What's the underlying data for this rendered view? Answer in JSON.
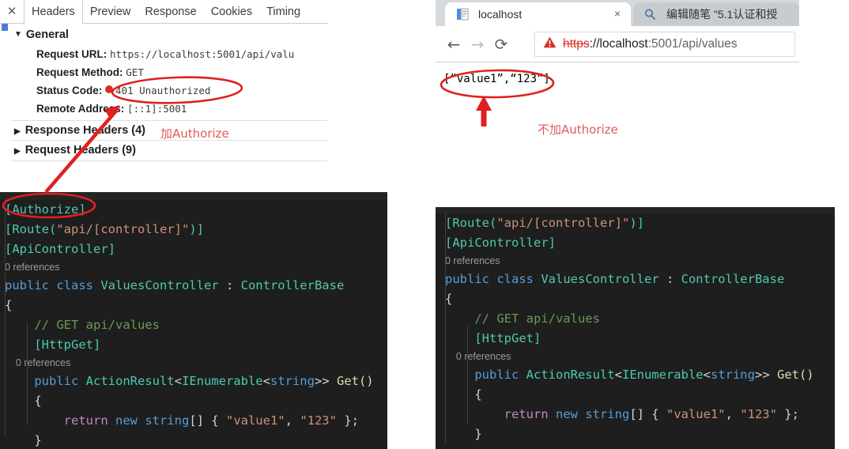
{
  "devtools": {
    "close_icon": "close-icon",
    "tabs": [
      {
        "label": "Headers",
        "selected": true
      },
      {
        "label": "Preview",
        "selected": false
      },
      {
        "label": "Response",
        "selected": false
      },
      {
        "label": "Cookies",
        "selected": false
      },
      {
        "label": "Timing",
        "selected": false
      }
    ],
    "general": {
      "section_label": "General",
      "caret": "▼",
      "rows": [
        {
          "key": "Request URL:",
          "value": "https://localhost:5001/api/valu"
        },
        {
          "key": "Request Method:",
          "value": "GET"
        },
        {
          "key": "Status Code:",
          "value": "401 Unauthorized",
          "status_color": "#d93025"
        },
        {
          "key": "Remote Address:",
          "value": "[::1]:5001"
        }
      ]
    },
    "sections": [
      {
        "label": "Response Headers (4)",
        "caret": "▶"
      },
      {
        "label": "Request Headers (9)",
        "caret": "▶"
      }
    ]
  },
  "annotations": {
    "left_note": "加Authorize",
    "right_note": "不加Authorize",
    "color": "#e05a5a"
  },
  "browser": {
    "tabs": [
      {
        "label": "localhost",
        "active": true,
        "close_icon": "×"
      },
      {
        "label": "编辑随笔 \"5.1认证和授",
        "active": false
      }
    ],
    "nav": {
      "back": "←",
      "forward": "→",
      "reload": "⟳"
    },
    "omnibox": {
      "security_icon": "not-secure-warning-icon",
      "scheme": "https",
      "separator": "://",
      "host": "localhost",
      "rest": ":5001/api/values"
    },
    "page_response": "[“value1”,“123”]"
  },
  "code_left": {
    "lines": [
      [
        {
          "t": "attr",
          "s": "[Authorize]"
        }
      ],
      [
        {
          "t": "attr",
          "s": "[Route("
        },
        {
          "t": "str",
          "s": "\"api/[controller]\""
        },
        {
          "t": "attr",
          "s": ")]"
        }
      ],
      [
        {
          "t": "attr",
          "s": "[ApiController]"
        }
      ],
      [
        {
          "t": "ref",
          "s": "0 references"
        }
      ],
      [
        {
          "t": "kw",
          "s": "public "
        },
        {
          "t": "kw",
          "s": "class "
        },
        {
          "t": "type",
          "s": "ValuesController"
        },
        {
          "t": "plain",
          "s": " : "
        },
        {
          "t": "type",
          "s": "ControllerBase"
        }
      ],
      [
        {
          "t": "plain",
          "s": "{"
        }
      ],
      [
        {
          "t": "cmt",
          "s": "    // GET api/values"
        }
      ],
      [
        {
          "t": "attr",
          "s": "    [HttpGet]"
        }
      ],
      [
        {
          "t": "ref",
          "s": "    0 references"
        }
      ],
      [
        {
          "t": "kw",
          "s": "    public "
        },
        {
          "t": "type",
          "s": "ActionResult"
        },
        {
          "t": "plain",
          "s": "<"
        },
        {
          "t": "type",
          "s": "IEnumerable"
        },
        {
          "t": "plain",
          "s": "<"
        },
        {
          "t": "kw",
          "s": "string"
        },
        {
          "t": "plain",
          "s": ">> "
        },
        {
          "t": "fn",
          "s": "Get()"
        }
      ],
      [
        {
          "t": "plain",
          "s": "    {"
        }
      ],
      [
        {
          "t": "ctl",
          "s": "        return "
        },
        {
          "t": "kw",
          "s": "new "
        },
        {
          "t": "kw",
          "s": "string"
        },
        {
          "t": "plain",
          "s": "[] { "
        },
        {
          "t": "str",
          "s": "\"value1\""
        },
        {
          "t": "plain",
          "s": ", "
        },
        {
          "t": "str",
          "s": "\"123\""
        },
        {
          "t": "plain",
          "s": " };"
        }
      ],
      [
        {
          "t": "plain",
          "s": "    }"
        }
      ]
    ]
  },
  "code_right": {
    "lines": [
      [
        {
          "t": "attr",
          "s": "[Route("
        },
        {
          "t": "str",
          "s": "\"api/[controller]\""
        },
        {
          "t": "attr",
          "s": ")]"
        }
      ],
      [
        {
          "t": "attr",
          "s": "[ApiController]"
        }
      ],
      [
        {
          "t": "ref",
          "s": "0 references"
        }
      ],
      [
        {
          "t": "kw",
          "s": "public "
        },
        {
          "t": "kw",
          "s": "class "
        },
        {
          "t": "type",
          "s": "ValuesController"
        },
        {
          "t": "plain",
          "s": " : "
        },
        {
          "t": "type",
          "s": "ControllerBase"
        }
      ],
      [
        {
          "t": "plain",
          "s": "{"
        }
      ],
      [
        {
          "t": "cmt",
          "s": "    // GET api/values"
        }
      ],
      [
        {
          "t": "attr",
          "s": "    [HttpGet]"
        }
      ],
      [
        {
          "t": "ref",
          "s": "    0 references"
        }
      ],
      [
        {
          "t": "kw",
          "s": "    public "
        },
        {
          "t": "type",
          "s": "ActionResult"
        },
        {
          "t": "plain",
          "s": "<"
        },
        {
          "t": "type",
          "s": "IEnumerable"
        },
        {
          "t": "plain",
          "s": "<"
        },
        {
          "t": "kw",
          "s": "string"
        },
        {
          "t": "plain",
          "s": ">> "
        },
        {
          "t": "fn",
          "s": "Get()"
        }
      ],
      [
        {
          "t": "plain",
          "s": "    {"
        }
      ],
      [
        {
          "t": "ctl",
          "s": "        return "
        },
        {
          "t": "kw",
          "s": "new "
        },
        {
          "t": "kw",
          "s": "string"
        },
        {
          "t": "plain",
          "s": "[] { "
        },
        {
          "t": "str",
          "s": "\"value1\""
        },
        {
          "t": "plain",
          "s": ", "
        },
        {
          "t": "str",
          "s": "\"123\""
        },
        {
          "t": "plain",
          "s": " };"
        }
      ],
      [
        {
          "t": "plain",
          "s": "    }"
        }
      ]
    ]
  }
}
